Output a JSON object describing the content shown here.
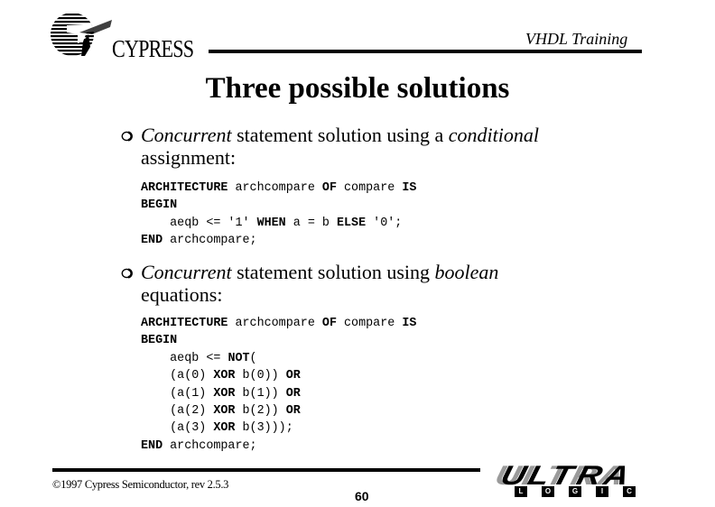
{
  "header": {
    "brand": "CYPRESS",
    "course_title": "VHDL Training"
  },
  "slide": {
    "title": "Three possible solutions",
    "bullets": [
      {
        "icon": "hollow-circle-bullet",
        "italic1": "Concurrent",
        "text1": " statement solution using a ",
        "italic2": "conditional",
        "line2": "assignment:"
      },
      {
        "icon": "hollow-circle-bullet",
        "italic1": "Concurrent",
        "text1": " statement solution using ",
        "italic2": "boolean",
        "line2": "equations:"
      }
    ],
    "code_blocks": [
      {
        "lines": [
          [
            {
              "t": "ARCHITECTURE",
              "b": true
            },
            {
              "t": " archcompare "
            },
            {
              "t": "OF",
              "b": true
            },
            {
              "t": " compare "
            },
            {
              "t": "IS",
              "b": true
            }
          ],
          [
            {
              "t": "BEGIN",
              "b": true
            }
          ],
          [
            {
              "t": "    aeqb <= '1' "
            },
            {
              "t": "WHEN",
              "b": true
            },
            {
              "t": " a = b "
            },
            {
              "t": "ELSE",
              "b": true
            },
            {
              "t": " '0';"
            }
          ],
          [
            {
              "t": "END",
              "b": true
            },
            {
              "t": " archcompare;"
            }
          ]
        ]
      },
      {
        "lines": [
          [
            {
              "t": "ARCHITECTURE",
              "b": true
            },
            {
              "t": " archcompare "
            },
            {
              "t": "OF",
              "b": true
            },
            {
              "t": " compare "
            },
            {
              "t": "IS",
              "b": true
            }
          ],
          [
            {
              "t": "BEGIN",
              "b": true
            }
          ],
          [
            {
              "t": "    aeqb <= "
            },
            {
              "t": "NOT",
              "b": true
            },
            {
              "t": "("
            }
          ],
          [
            {
              "t": "    (a(0) "
            },
            {
              "t": "XOR",
              "b": true
            },
            {
              "t": " b(0)) "
            },
            {
              "t": "OR",
              "b": true
            }
          ],
          [
            {
              "t": "    (a(1) "
            },
            {
              "t": "XOR",
              "b": true
            },
            {
              "t": " b(1)) "
            },
            {
              "t": "OR",
              "b": true
            }
          ],
          [
            {
              "t": "    (a(2) "
            },
            {
              "t": "XOR",
              "b": true
            },
            {
              "t": " b(2)) "
            },
            {
              "t": "OR",
              "b": true
            }
          ],
          [
            {
              "t": "    (a(3) "
            },
            {
              "t": "XOR",
              "b": true
            },
            {
              "t": " b(3)));"
            }
          ],
          [
            {
              "t": "END",
              "b": true
            },
            {
              "t": " archcompare;"
            }
          ]
        ]
      }
    ]
  },
  "footer": {
    "copyright": "©1997 Cypress Semiconductor, rev 2.5.3",
    "page_number": "60",
    "logo": {
      "ultra": [
        "U",
        "L",
        "T",
        "R",
        "A"
      ],
      "logic": [
        "L",
        "O",
        "G",
        "I",
        "C"
      ]
    }
  }
}
